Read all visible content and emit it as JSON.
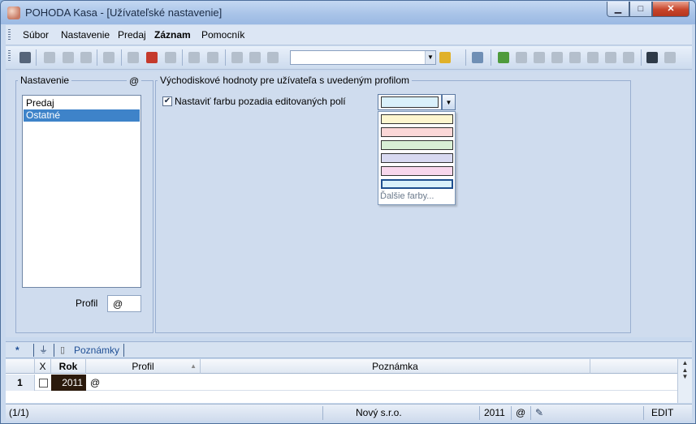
{
  "window": {
    "title": "POHODA Kasa - [Užívateľské nastavenie]",
    "controls": {
      "minimize": "▁",
      "maximize": "□",
      "close": "✕"
    }
  },
  "menu": {
    "items": [
      "Súbor",
      "Nastavenie",
      "Predaj",
      "Záznam",
      "Pomocník"
    ]
  },
  "toolbar": {
    "combo_value": ""
  },
  "settings_panel": {
    "group_label": "Nastavenie",
    "at_symbol": "@",
    "list_items": [
      "Predaj",
      "Ostatné"
    ],
    "selected_item": "Ostatné",
    "profil_label": "Profil",
    "profil_value": "@"
  },
  "defaults_panel": {
    "group_label": "Východiskové hodnoty pre užívateľa s uvedeným profilom",
    "checkbox_label": "Nastaviť farbu pozadia editovaných polí",
    "checkbox_checked": true,
    "selected_color": "#daf1fb",
    "color_options": [
      "#fdf6cf",
      "#fbd7d7",
      "#d8efd5",
      "#d8d9f1",
      "#f8d7ec",
      "#daf1fb"
    ],
    "more_colors_label": "Ďalšie farby..."
  },
  "tabs": {
    "items": [
      "*",
      "Poznámky"
    ],
    "filter_icon": "filter-icon"
  },
  "grid": {
    "columns": [
      "X",
      "Rok",
      "Profil",
      "Poznámka"
    ],
    "rows": [
      {
        "num": "1",
        "x": "",
        "rok": "2011",
        "profil": "@",
        "poznamka": ""
      }
    ]
  },
  "status": {
    "record": "(1/1)",
    "company": "Nový s.r.o.",
    "year": "2011",
    "at": "@",
    "mode": "EDIT"
  }
}
